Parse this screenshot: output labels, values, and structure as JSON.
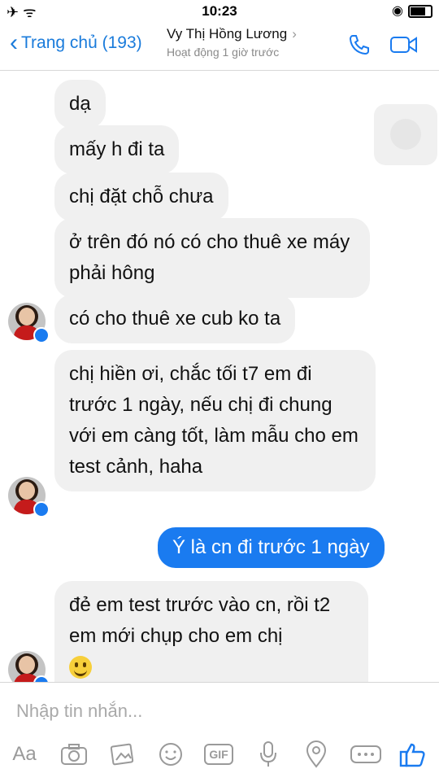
{
  "status_bar": {
    "time": "10:23"
  },
  "header": {
    "back_label": "Trang chủ (193)",
    "contact_name": "Vy Thị Hồng Lương",
    "activity": "Hoạt động 1 giờ trước",
    "icons": [
      "chevron-left-icon",
      "chevron-right-icon",
      "phone-icon",
      "video-camera-icon"
    ]
  },
  "messages": [
    {
      "from": "them",
      "text": "dạ"
    },
    {
      "from": "them",
      "text": "mấy h đi ta"
    },
    {
      "from": "them",
      "text": "chị đặt chỗ chưa"
    },
    {
      "from": "them",
      "text": "ở trên đó nó có cho thuê xe máy phải hông"
    },
    {
      "from": "them",
      "text": "có cho thuê xe cub ko ta"
    },
    {
      "from": "them",
      "text": "chị hiền ơi, chắc tối t7 em đi trước 1 ngày, nếu chị đi chung với em càng tốt, làm mẫu cho em test cảnh, haha"
    },
    {
      "from": "me",
      "text": "Ý là cn đi trước 1 ngày"
    },
    {
      "from": "them",
      "text": "đẻ em test trước vào cn, rồi t2 em mới chụp cho em chị"
    }
  ],
  "composer": {
    "placeholder": "Nhập tin nhắn...",
    "aa_label": "Aa",
    "gif_label": "GIF",
    "icons": [
      "text-format-icon",
      "camera-icon",
      "gallery-icon",
      "emoji-icon",
      "gif-icon",
      "microphone-icon",
      "location-icon",
      "more-icon",
      "like-icon"
    ]
  },
  "colors": {
    "accent": "#1a7bf0",
    "bubble_them": "#f0f0f0",
    "bubble_me": "#1a7bf0"
  }
}
